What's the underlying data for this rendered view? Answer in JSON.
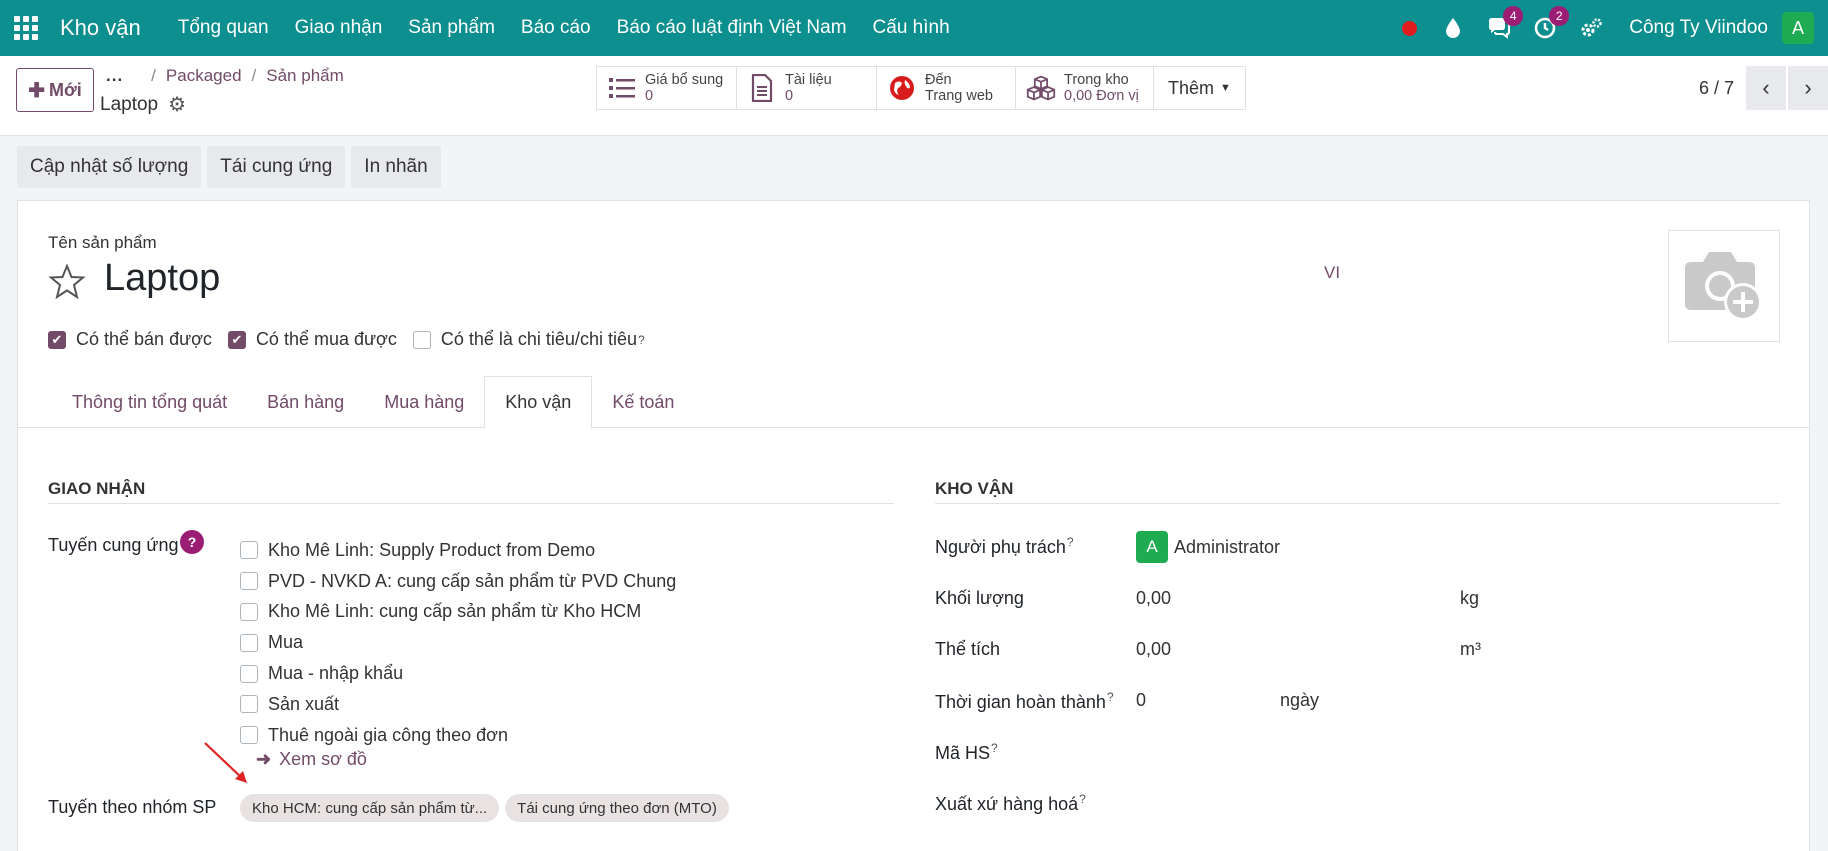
{
  "navbar": {
    "brand": "Kho vận",
    "menu": [
      "Tổng quan",
      "Giao nhận",
      "Sản phẩm",
      "Báo cáo",
      "Báo cáo luật định Việt Nam",
      "Cấu hình"
    ],
    "chat_badge": "4",
    "activity_badge": "2",
    "company": "Công Ty Viindoo",
    "avatar": "A"
  },
  "control": {
    "new_label": "Mới",
    "breadcrumb_dots": "...",
    "breadcrumb": [
      "Packaged",
      "Sản phẩm"
    ],
    "record_title": "Laptop",
    "smart_buttons": {
      "extra_price": {
        "label": "Giá bổ sung",
        "value": "0"
      },
      "documents": {
        "label": "Tài liệu",
        "value": "0"
      },
      "website": {
        "label1": "Đến",
        "label2": "Trang web"
      },
      "stock": {
        "label": "Trong kho",
        "value": "0,00 Đơn vị"
      },
      "more": "Thêm"
    },
    "pager": "6 / 7"
  },
  "actions": [
    "Cập nhật số lượng",
    "Tái cung ứng",
    "In nhãn"
  ],
  "form": {
    "name_label": "Tên sản phẩm",
    "name": "Laptop",
    "lang": "VI",
    "checkboxes": [
      {
        "label": "Có thể bán được",
        "checked": true
      },
      {
        "label": "Có thể mua được",
        "checked": true
      },
      {
        "label": "Có thể là chi tiêu/chi tiêu",
        "checked": false
      }
    ],
    "tabs": [
      "Thông tin tổng quát",
      "Bán hàng",
      "Mua hàng",
      "Kho vận",
      "Kế toán"
    ],
    "active_tab": "Kho vận",
    "giao_nhan": {
      "title": "GIAO NHẬN",
      "routes_label": "Tuyến cung ứng",
      "routes": [
        "Kho Mê Linh: Supply Product from Demo",
        "PVD - NVKD A: cung cấp sản phẩm từ PVD Chung",
        "Kho Mê Linh: cung cấp sản phẩm từ Kho HCM",
        "Mua",
        "Mua - nhập khẩu",
        "Sản xuất",
        "Thuê ngoài gia công theo đơn"
      ],
      "view_diagram": "Xem sơ đồ",
      "categ_routes_label": "Tuyến theo nhóm SP",
      "categ_routes": [
        "Kho HCM: cung cấp sản phẩm từ...",
        "Tái cung ứng theo đơn (MTO)"
      ]
    },
    "kho_van": {
      "title": "KHO VẬN",
      "responsible_label": "Người phụ trách",
      "responsible": "Administrator",
      "responsible_avatar": "A",
      "weight_label": "Khối lượng",
      "weight": "0,00",
      "weight_uom": "kg",
      "volume_label": "Thể tích",
      "volume": "0,00",
      "volume_uom": "m³",
      "lead_label": "Thời gian hoàn thành",
      "lead": "0",
      "lead_uom": "ngày",
      "hs_label": "Mã HS",
      "origin_label": "Xuất xứ hàng hoá"
    }
  }
}
